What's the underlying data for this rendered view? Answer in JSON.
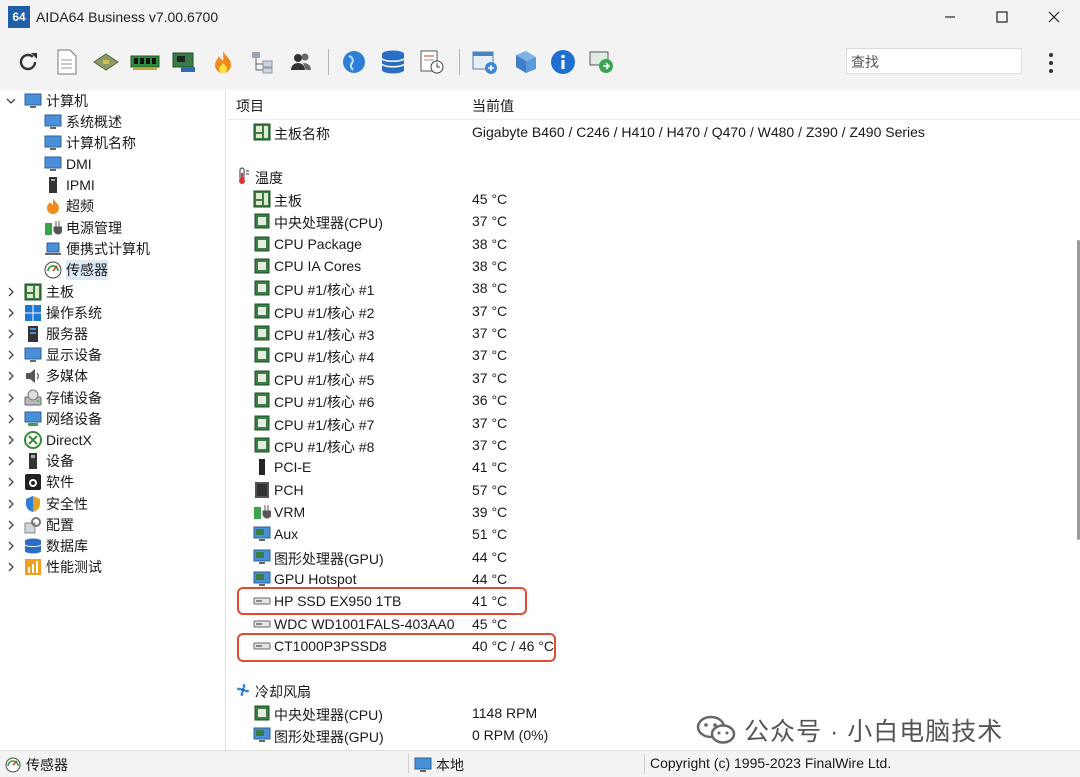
{
  "window": {
    "title": "AIDA64 Business v7.00.6700",
    "app_icon_text": "64"
  },
  "toolbar": {
    "search_placeholder": "查找"
  },
  "tree": {
    "root_label": "计算机",
    "computer_children": [
      "系统概述",
      "计算机名称",
      "DMI",
      "IPMI",
      "超频",
      "电源管理",
      "便携式计算机",
      "传感器"
    ],
    "top_level": [
      "主板",
      "操作系统",
      "服务器",
      "显示设备",
      "多媒体",
      "存储设备",
      "网络设备",
      "DirectX",
      "设备",
      "软件",
      "安全性",
      "配置",
      "数据库",
      "性能测试"
    ]
  },
  "list": {
    "col_item": "项目",
    "col_value": "当前值",
    "board_label": "主板名称",
    "board_value": "Gigabyte B460 / C246 / H410 / H470 / Q470 / W480 / Z390 / Z490 Series",
    "temp_section": "温度",
    "temps": [
      {
        "label": "主板",
        "value": "45 °C"
      },
      {
        "label": "中央处理器(CPU)",
        "value": "37 °C"
      },
      {
        "label": "CPU Package",
        "value": "38 °C"
      },
      {
        "label": "CPU IA Cores",
        "value": "38 °C"
      },
      {
        "label": "CPU #1/核心 #1",
        "value": "38 °C"
      },
      {
        "label": "CPU #1/核心 #2",
        "value": "37 °C"
      },
      {
        "label": "CPU #1/核心 #3",
        "value": "37 °C"
      },
      {
        "label": "CPU #1/核心 #4",
        "value": "37 °C"
      },
      {
        "label": "CPU #1/核心 #5",
        "value": "37 °C"
      },
      {
        "label": "CPU #1/核心 #6",
        "value": "36 °C"
      },
      {
        "label": "CPU #1/核心 #7",
        "value": "37 °C"
      },
      {
        "label": "CPU #1/核心 #8",
        "value": "37 °C"
      },
      {
        "label": "PCI-E",
        "value": "41 °C"
      },
      {
        "label": "PCH",
        "value": "57 °C"
      },
      {
        "label": "VRM",
        "value": "39 °C"
      },
      {
        "label": "Aux",
        "value": "51 °C"
      },
      {
        "label": "图形处理器(GPU)",
        "value": "44 °C"
      },
      {
        "label": "GPU Hotspot",
        "value": "44 °C"
      },
      {
        "label": "HP SSD EX950 1TB",
        "value": "41 °C"
      },
      {
        "label": "WDC WD1001FALS-403AA0",
        "value": "45 °C"
      },
      {
        "label": "CT1000P3PSSD8",
        "value": "40 °C / 46 °C"
      }
    ],
    "fan_section": "冷却风扇",
    "fans": [
      {
        "label": "中央处理器(CPU)",
        "value": "1148 RPM"
      },
      {
        "label": "图形处理器(GPU)",
        "value": "0 RPM  (0%)"
      }
    ]
  },
  "status": {
    "left": "传感器",
    "middle": "本地",
    "right": "Copyright (c) 1995-2023 FinalWire Ltd."
  },
  "watermark": "公众号 · 小白电脑技术",
  "colors": {
    "highlight": "#e24a35",
    "selection": "#dce9f7",
    "chrome": "#f3f3f3"
  }
}
